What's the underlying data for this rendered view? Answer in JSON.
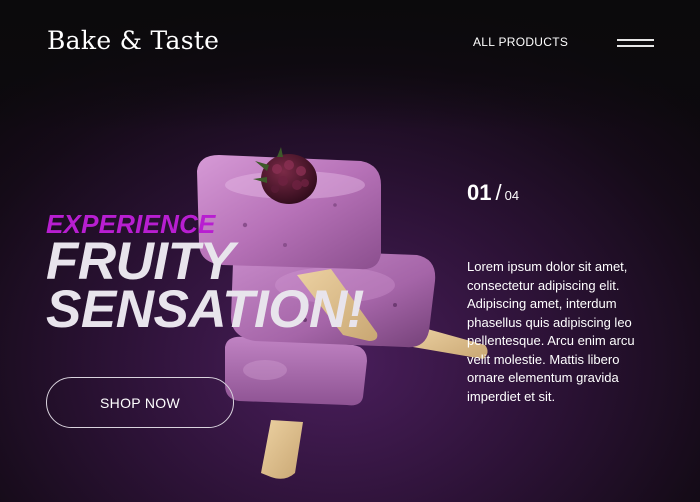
{
  "header": {
    "logo": "Bake & Taste",
    "nav_link": "ALL PRODUCTS"
  },
  "hero": {
    "eyebrow": "EXPERIENCE",
    "headline_line1": "FRUITY",
    "headline_line2": "SENSATION!",
    "cta_label": "SHOP NOW",
    "slide_current": "01",
    "slide_separator": "/",
    "slide_total": "04",
    "description": "Lorem ipsum dolor sit amet, consectetur adipiscing elit. Adipiscing amet, interdum phasellus quis adipiscing leo pellentesque. Arcu enim arcu velit molestie. Mattis libero ornare elementum gravida imperdiet et sit."
  },
  "colors": {
    "accent": "#b81ed1",
    "headline": "#e8e4ec",
    "background_dark": "#0d090e",
    "background_glow": "#4a1e5c"
  },
  "icons": {
    "menu": "hamburger-menu-icon"
  }
}
